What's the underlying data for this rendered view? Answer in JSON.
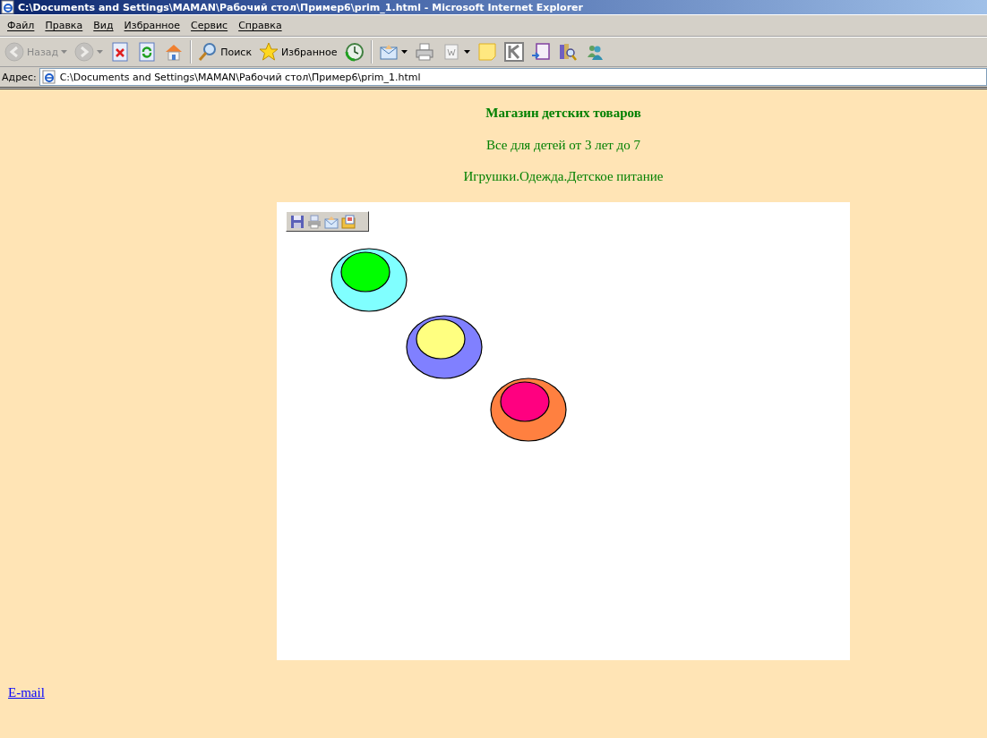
{
  "window": {
    "title": "C:\\Documents and Settings\\MAMAN\\Рабочий стол\\Пример6\\prim_1.html - Microsoft Internet Explorer"
  },
  "menu": [
    "Файл",
    "Правка",
    "Вид",
    "Избранное",
    "Сервис",
    "Справка"
  ],
  "toolbar": [
    {
      "kind": "back",
      "label": "Назад",
      "disabled": true
    },
    {
      "kind": "forward",
      "disabled": true
    },
    {
      "kind": "stop"
    },
    {
      "kind": "refresh"
    },
    {
      "kind": "home"
    },
    {
      "kind": "separator"
    },
    {
      "kind": "search",
      "label": "Поиск"
    },
    {
      "kind": "favorites",
      "label": "Избранное"
    },
    {
      "kind": "history"
    },
    {
      "kind": "separator"
    },
    {
      "kind": "mail"
    },
    {
      "kind": "print"
    },
    {
      "kind": "edit"
    },
    {
      "kind": "note"
    },
    {
      "kind": "k"
    },
    {
      "kind": "onenote"
    },
    {
      "kind": "research"
    },
    {
      "kind": "messenger"
    }
  ],
  "address": {
    "label": "Адрес:",
    "value": "C:\\Documents and Settings\\MAMAN\\Рабочий стол\\Пример6\\prim_1.html"
  },
  "page": {
    "heading": "Магазин детских товаров",
    "subtitle": "Все для детей от 3 лет до 7",
    "categories": "Игрушки.Одежда.Детское питание",
    "image_toolbar": [
      {
        "kind": "save"
      },
      {
        "kind": "print"
      },
      {
        "kind": "mail"
      },
      {
        "kind": "folder"
      }
    ],
    "shapes": [
      {
        "outer": {
          "color": "#80ffff"
        },
        "inner": {
          "color": "#00ff00"
        }
      },
      {
        "outer": {
          "color": "#8080ff"
        },
        "inner": {
          "color": "#ffff80"
        }
      },
      {
        "outer": {
          "color": "#ff8040"
        },
        "inner": {
          "color": "#ff0080"
        }
      }
    ],
    "link": "E-mail"
  }
}
